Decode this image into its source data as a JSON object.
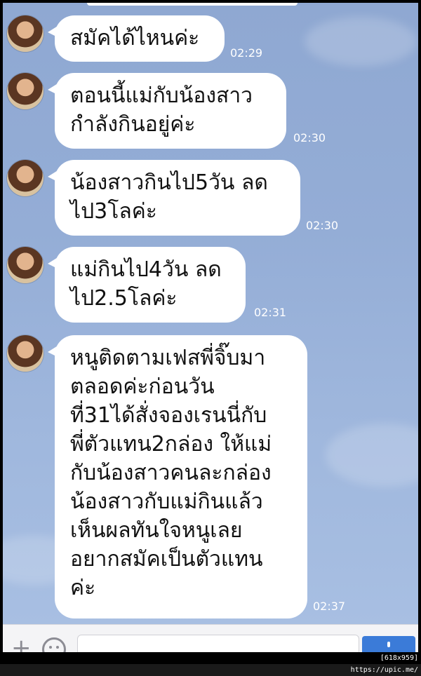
{
  "messages": [
    {
      "text": "สมัคได้ไหนค่ะ",
      "time": "02:29"
    },
    {
      "text": "ตอนนี้แม่กับน้องสาว\nกำลังกินอยู่ค่ะ",
      "time": "02:30"
    },
    {
      "text": "น้องสาวกินไป5วัน ลด\nไป3โลค่ะ",
      "time": "02:30"
    },
    {
      "text": "แม่กินไป4วัน ลด\nไป2.5โลค่ะ",
      "time": "02:31"
    },
    {
      "text": "หนูติดตามเฟสพี่จิ๊บมา\nตลอดค่ะก่อนวัน\nที่31ได้สั่งจองเรนนี่กับ\nพี่ตัวแทน2กล่อง ให้แม่\nกับน้องสาวคนละกล่อง\nน้องสาวกับแม่กินแล้ว\nเห็นผลทันใจหนูเลย\nอยากสมัคเป็นตัวแทน\nค่ะ",
      "time": "02:37"
    }
  ],
  "input_bar": {
    "plus_icon": "plus-icon",
    "emoji_icon": "smiley-icon",
    "send_icon": "send-icon"
  },
  "watermark": "[618x959] https://upic.me/"
}
